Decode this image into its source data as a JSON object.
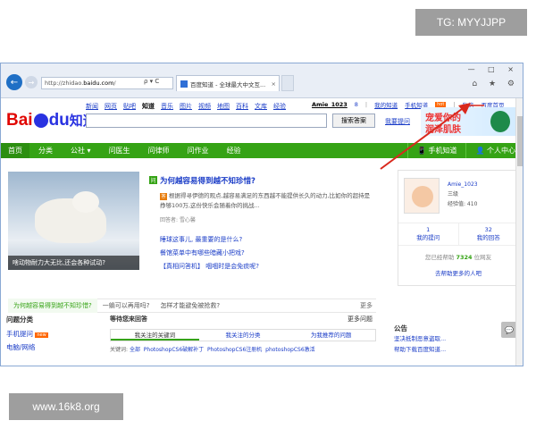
{
  "watermark_top": "TG: MYYJJPP",
  "watermark_bottom": "www.16k8.org",
  "browser": {
    "address": "http://zhidao.baidu.com/",
    "address_prefix": "http://zhidao.",
    "address_domain": "baidu.com",
    "address_suffix": "/",
    "addr_tools": "ρ ▾ C",
    "tab_title": "百度知道 - 全球最大中文互...",
    "tab_close": "×",
    "window_controls": "— □ ×",
    "tool_icons": "⌂ ★ ⚙"
  },
  "logo": {
    "bai": "Bai",
    "du": "du",
    "zhidao": "知道"
  },
  "channels": [
    "新闻",
    "网页",
    "贴吧",
    "知道",
    "音乐",
    "图片",
    "视频",
    "地图",
    "百科",
    "文库",
    "经验"
  ],
  "current_channel": "知道",
  "search": {
    "button": "搜索答案"
  },
  "top_user": {
    "username": "Amie_1023",
    "msg": "8",
    "my_zhidao": "我的知道",
    "mobile": "手机知道",
    "hot": "hot",
    "private_msg": "私信",
    "homepage": "百度首页"
  },
  "my_question": "我要提问",
  "banner": {
    "line1": "宠爱你的",
    "line2": "润泽肌肤"
  },
  "green_nav": {
    "home": "首页",
    "items": [
      "分类",
      "公社 ▾",
      "问医生",
      "问律师",
      "问作业",
      "经验"
    ],
    "right": [
      "📱 手机知道",
      "👤 个人中心"
    ]
  },
  "feature": {
    "caption": "啥动物耐力大无比,还会各种试动?"
  },
  "question": {
    "icon": "问",
    "title": "为何越容易得到越不知珍惜?",
    "answer_icon": "答",
    "desc": "根据得寻伊德的观点,越容易满足的东西越不能提供长久的动力,比如你的超持是挣够100万,这份快乐会随着你的挑战...",
    "meta": "回答者: 雪心馨",
    "links": [
      "睡球这事儿, 最重要的是什么?",
      "餐馆菜单中有哪些暗藏小把戏?",
      "【真相问答机】 咽咽时是会免痰呢?"
    ]
  },
  "user_panel": {
    "name": "Amie_1023",
    "level": "三级",
    "points": "经验值: 410",
    "stat1_num": "1",
    "stat1_label": "我的提问",
    "stat2_num": "32",
    "stat2_label": "我的回答",
    "helped_prefix": "您已经帮助 ",
    "helped_count": "7324",
    "helped_suffix": " 位网友",
    "share": "去帮助更多的人吧"
  },
  "tags": [
    "为何越容易得到越不知珍惜?",
    "一躺可以再用吗?",
    "怎样才能避免被抢救?"
  ],
  "tags_more": "更多",
  "left_col": {
    "header": "问题分类",
    "items": [
      "手机提问",
      "电脑/网络"
    ],
    "new": "new"
  },
  "mid_col": {
    "header": "等待您来回答",
    "more": "更多问题",
    "tabs": [
      "我关注的关键词",
      "我关注的分类",
      "为我推荐的问题"
    ],
    "kw_label": "关键词:",
    "kw_items": [
      "全部",
      "PhotoshopCS6破解补丁",
      "PhotoshopCS6注册机",
      "photoshopCS6激活"
    ]
  },
  "notice": {
    "header": "公告",
    "items": [
      "坚决抵制恶意盗取...",
      "帮助下载百度知道..."
    ]
  },
  "feedback_icon": "💬"
}
